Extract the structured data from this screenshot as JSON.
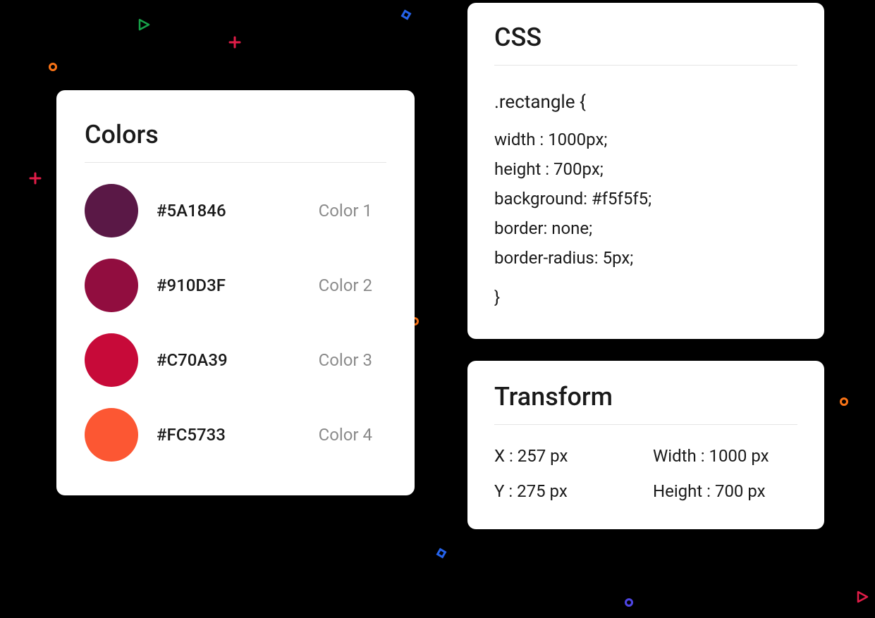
{
  "colors_panel": {
    "title": "Colors",
    "items": [
      {
        "hex": "#5A1846",
        "label": "Color 1",
        "swatch": "#5A1846"
      },
      {
        "hex": "#910D3F",
        "label": "Color 2",
        "swatch": "#910D3F"
      },
      {
        "hex": "#C70A39",
        "label": "Color 3",
        "swatch": "#C70A39"
      },
      {
        "hex": "#FC5733",
        "label": "Color 4",
        "swatch": "#FC5733"
      }
    ]
  },
  "css_panel": {
    "title": "CSS",
    "selector": ".rectangle {",
    "props": [
      "width : 1000px;",
      "height : 700px;",
      "background: #f5f5f5;",
      "border: none;",
      "border-radius: 5px;"
    ],
    "close": "}"
  },
  "transform_panel": {
    "title": "Transform",
    "x": "X : 257 px",
    "y": "Y : 275 px",
    "width": "Width : 1000 px",
    "height": "Height : 700 px"
  }
}
